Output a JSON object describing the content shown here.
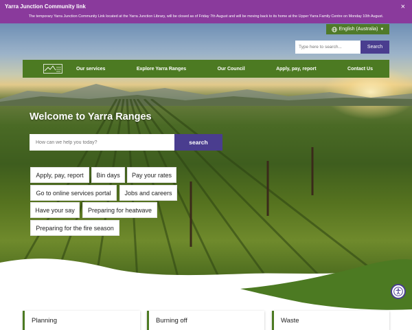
{
  "alert": {
    "title": "Yarra Junction Community link",
    "body": "The temporary Yarra Junction Community Link located at the Yarra Junction Library, will be closed as of Friday 7th August and will be moving back to its home at the Upper Yarra Family Centre on Monday 10th August.",
    "close": "×",
    "bg_color": "#8a3a9c"
  },
  "language": {
    "label": "English (Australia)",
    "icon": "globe-icon"
  },
  "top_search": {
    "placeholder": "Type here to search...",
    "button": "Search"
  },
  "nav": {
    "logo": "yarra-ranges-logo",
    "items": [
      {
        "label": "Our services"
      },
      {
        "label": "Explore Yarra Ranges"
      },
      {
        "label": "Our Council"
      },
      {
        "label": "Apply, pay, report"
      },
      {
        "label": "Contact Us"
      }
    ],
    "bg_color": "#4c7a22"
  },
  "hero": {
    "title": "Welcome to Yarra Ranges",
    "search_placeholder": "How can we help you today?",
    "search_button": "search",
    "accent_color": "#4a3d8f"
  },
  "quick_links": [
    {
      "label": "Apply, pay, report"
    },
    {
      "label": "Bin days"
    },
    {
      "label": "Pay your rates"
    },
    {
      "label": "Go to online services portal"
    },
    {
      "label": "Jobs and careers"
    },
    {
      "label": "Have your say"
    },
    {
      "label": "Preparing for heatwave"
    },
    {
      "label": "Preparing for the fire season"
    }
  ],
  "accessibility": {
    "icon": "accessibility-icon"
  },
  "cards": [
    {
      "label": "Planning"
    },
    {
      "label": "Burning off"
    },
    {
      "label": "Waste"
    }
  ]
}
